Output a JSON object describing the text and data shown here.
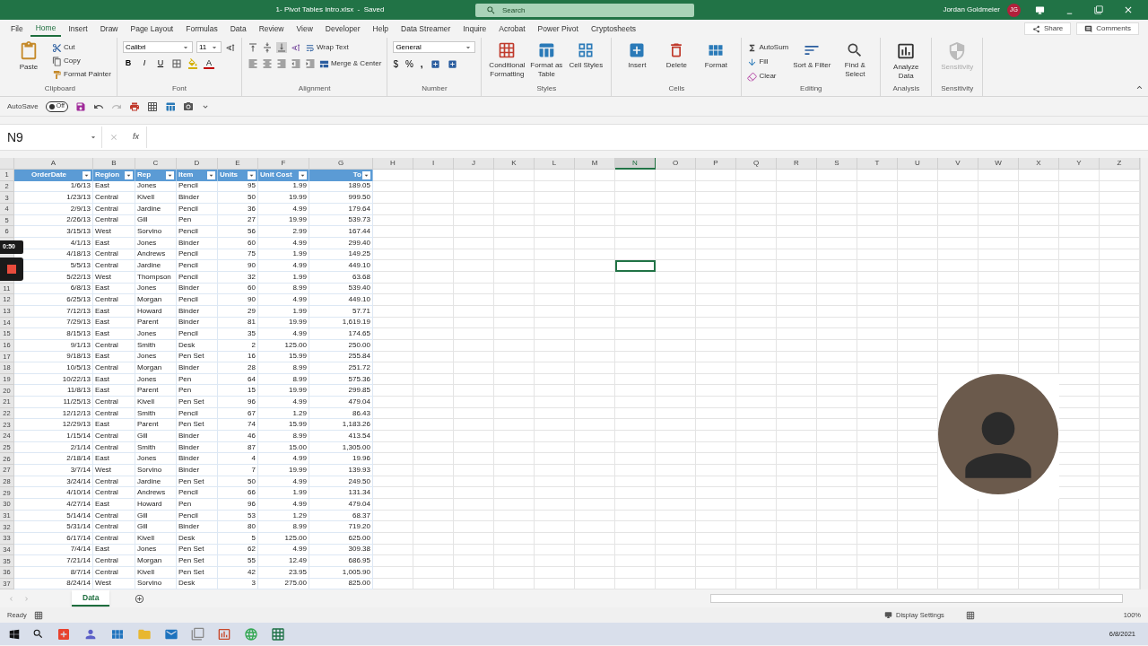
{
  "title_bar": {
    "document_title": "1- Pivot Tables Intro.xlsx  -  Saved",
    "search_placeholder": "Search",
    "user_name": "Jordan Goldmeier",
    "user_initials": "JG"
  },
  "menu_tabs": [
    {
      "label": "File",
      "selected": false
    },
    {
      "label": "Home",
      "selected": true
    },
    {
      "label": "Insert",
      "selected": false
    },
    {
      "label": "Draw",
      "selected": false
    },
    {
      "label": "Page Layout",
      "selected": false
    },
    {
      "label": "Formulas",
      "selected": false
    },
    {
      "label": "Data",
      "selected": false
    },
    {
      "label": "Review",
      "selected": false
    },
    {
      "label": "View",
      "selected": false
    },
    {
      "label": "Developer",
      "selected": false
    },
    {
      "label": "Help",
      "selected": false
    },
    {
      "label": "Data Streamer",
      "selected": false
    },
    {
      "label": "Inquire",
      "selected": false
    },
    {
      "label": "Acrobat",
      "selected": false
    },
    {
      "label": "Power Pivot",
      "selected": false
    },
    {
      "label": "Cryptosheets",
      "selected": false
    }
  ],
  "share": "Share",
  "comments": "Comments",
  "ribbon": {
    "groups": [
      {
        "kind": "clipboard",
        "label": "Clipboard",
        "paste": "Paste",
        "cut": "Cut",
        "copy": "Copy",
        "format_painter": "Format Painter"
      },
      {
        "kind": "font",
        "label": "Font",
        "font_name": "Calibri",
        "font_size": "11",
        "bold": "B",
        "italic": "I",
        "underline": "U",
        "font_color": "A"
      },
      {
        "kind": "alignment",
        "label": "Alignment",
        "wrap_text": "Wrap Text",
        "merge_center": "Merge & Center"
      },
      {
        "kind": "number",
        "label": "Number",
        "format": "General",
        "currency": "$",
        "percent": "%",
        "comma": ","
      },
      {
        "kind": "styles",
        "label": "Styles",
        "buttons": [
          "Conditional Formatting",
          "Format as Table",
          "Cell Styles"
        ]
      },
      {
        "kind": "cells",
        "label": "Cells",
        "buttons": [
          "Insert",
          "Delete",
          "Format"
        ]
      },
      {
        "kind": "editing",
        "label": "Editing",
        "autosum": "AutoSum",
        "fill": "Fill",
        "clear": "Clear",
        "buttons": [
          "Sort & Filter",
          "Find & Select"
        ]
      },
      {
        "kind": "analysis",
        "label": "Analysis",
        "buttons": [
          "Analyze Data"
        ],
        "disabled": false
      },
      {
        "kind": "sensitivity",
        "label": "Sensitivity",
        "buttons": [
          "Sensitivity"
        ],
        "disabled": true
      }
    ]
  },
  "quick_access": {
    "autosave_label": "AutoSave",
    "autosave_state": "Off",
    "autosave_on": false
  },
  "formula_bar": {
    "name_box": "N9",
    "fx": "fx"
  },
  "columns": [
    {
      "label": "A",
      "selected": false
    },
    {
      "label": "B",
      "selected": false
    },
    {
      "label": "C",
      "selected": false
    },
    {
      "label": "D",
      "selected": false
    },
    {
      "label": "E",
      "selected": false
    },
    {
      "label": "F",
      "selected": false
    },
    {
      "label": "G",
      "selected": false
    },
    {
      "label": "H",
      "selected": false
    },
    {
      "label": "I",
      "selected": false
    },
    {
      "label": "J",
      "selected": false
    },
    {
      "label": "K",
      "selected": false
    },
    {
      "label": "L",
      "selected": false
    },
    {
      "label": "M",
      "selected": false
    },
    {
      "label": "N",
      "selected": true
    },
    {
      "label": "O",
      "selected": false
    },
    {
      "label": "P",
      "selected": false
    },
    {
      "label": "Q",
      "selected": false
    },
    {
      "label": "R",
      "selected": false
    },
    {
      "label": "S",
      "selected": false
    },
    {
      "label": "T",
      "selected": false
    },
    {
      "label": "U",
      "selected": false
    },
    {
      "label": "V",
      "selected": false
    },
    {
      "label": "W",
      "selected": false
    },
    {
      "label": "X",
      "selected": false
    },
    {
      "label": "Y",
      "selected": false
    },
    {
      "label": "Z",
      "selected": false
    }
  ],
  "rows": [
    {
      "kind": "header",
      "number": "1",
      "selected": false,
      "cells": [
        "OrderDate",
        "Region",
        "Rep",
        "Item",
        "Units",
        "Unit Cost",
        "To"
      ]
    },
    {
      "kind": "data",
      "number": "2",
      "selected": false,
      "cells": [
        "1/6/13",
        "East",
        "Jones",
        "Pencil",
        "95",
        "1.99",
        "189.05"
      ]
    },
    {
      "kind": "data",
      "number": "3",
      "selected": false,
      "cells": [
        "1/23/13",
        "Central",
        "Kivell",
        "Binder",
        "50",
        "19.99",
        "999.50"
      ]
    },
    {
      "kind": "data",
      "number": "4",
      "selected": false,
      "cells": [
        "2/9/13",
        "Central",
        "Jardine",
        "Pencil",
        "36",
        "4.99",
        "179.64"
      ]
    },
    {
      "kind": "data",
      "number": "5",
      "selected": false,
      "cells": [
        "2/26/13",
        "Central",
        "Gill",
        "Pen",
        "27",
        "19.99",
        "539.73"
      ]
    },
    {
      "kind": "data",
      "number": "6",
      "selected": false,
      "cells": [
        "3/15/13",
        "West",
        "Sorvino",
        "Pencil",
        "56",
        "2.99",
        "167.44"
      ]
    },
    {
      "kind": "data",
      "selected": false,
      "cells": [
        "4/1/13",
        "East",
        "Jones",
        "Binder",
        "60",
        "4.99",
        "299.40"
      ]
    },
    {
      "kind": "data",
      "selected": false,
      "cells": [
        "4/18/13",
        "Central",
        "Andrews",
        "Pencil",
        "75",
        "1.99",
        "149.25"
      ]
    },
    {
      "kind": "data",
      "selected": true,
      "cells": [
        "5/5/13",
        "Central",
        "Jardine",
        "Pencil",
        "90",
        "4.99",
        "449.10"
      ]
    },
    {
      "kind": "data",
      "selected": false,
      "cells": [
        "5/22/13",
        "West",
        "Thompson",
        "Pencil",
        "32",
        "1.99",
        "63.68"
      ]
    },
    {
      "kind": "data",
      "number": "11",
      "selected": false,
      "cells": [
        "6/8/13",
        "East",
        "Jones",
        "Binder",
        "60",
        "8.99",
        "539.40"
      ]
    },
    {
      "kind": "data",
      "number": "12",
      "selected": false,
      "cells": [
        "6/25/13",
        "Central",
        "Morgan",
        "Pencil",
        "90",
        "4.99",
        "449.10"
      ]
    },
    {
      "kind": "data",
      "number": "13",
      "selected": false,
      "cells": [
        "7/12/13",
        "East",
        "Howard",
        "Binder",
        "29",
        "1.99",
        "57.71"
      ]
    },
    {
      "kind": "data",
      "number": "14",
      "selected": false,
      "cells": [
        "7/29/13",
        "East",
        "Parent",
        "Binder",
        "81",
        "19.99",
        "1,619.19"
      ]
    },
    {
      "kind": "data",
      "number": "15",
      "selected": false,
      "cells": [
        "8/15/13",
        "East",
        "Jones",
        "Pencil",
        "35",
        "4.99",
        "174.65"
      ]
    },
    {
      "kind": "data",
      "number": "16",
      "selected": false,
      "cells": [
        "9/1/13",
        "Central",
        "Smith",
        "Desk",
        "2",
        "125.00",
        "250.00"
      ]
    },
    {
      "kind": "data",
      "number": "17",
      "selected": false,
      "cells": [
        "9/18/13",
        "East",
        "Jones",
        "Pen Set",
        "16",
        "15.99",
        "255.84"
      ]
    },
    {
      "kind": "data",
      "number": "18",
      "selected": false,
      "cells": [
        "10/5/13",
        "Central",
        "Morgan",
        "Binder",
        "28",
        "8.99",
        "251.72"
      ]
    },
    {
      "kind": "data",
      "number": "19",
      "selected": false,
      "cells": [
        "10/22/13",
        "East",
        "Jones",
        "Pen",
        "64",
        "8.99",
        "575.36"
      ]
    },
    {
      "kind": "data",
      "number": "20",
      "selected": false,
      "cells": [
        "11/8/13",
        "East",
        "Parent",
        "Pen",
        "15",
        "19.99",
        "299.85"
      ]
    },
    {
      "kind": "data",
      "number": "21",
      "selected": false,
      "cells": [
        "11/25/13",
        "Central",
        "Kivell",
        "Pen Set",
        "96",
        "4.99",
        "479.04"
      ]
    },
    {
      "kind": "data",
      "number": "22",
      "selected": false,
      "cells": [
        "12/12/13",
        "Central",
        "Smith",
        "Pencil",
        "67",
        "1.29",
        "86.43"
      ]
    },
    {
      "kind": "data",
      "number": "23",
      "selected": false,
      "cells": [
        "12/29/13",
        "East",
        "Parent",
        "Pen Set",
        "74",
        "15.99",
        "1,183.26"
      ]
    },
    {
      "kind": "data",
      "number": "24",
      "selected": false,
      "cells": [
        "1/15/14",
        "Central",
        "Gill",
        "Binder",
        "46",
        "8.99",
        "413.54"
      ]
    },
    {
      "kind": "data",
      "number": "25",
      "selected": false,
      "cells": [
        "2/1/14",
        "Central",
        "Smith",
        "Binder",
        "87",
        "15.00",
        "1,305.00"
      ]
    },
    {
      "kind": "data",
      "number": "26",
      "selected": false,
      "cells": [
        "2/18/14",
        "East",
        "Jones",
        "Binder",
        "4",
        "4.99",
        "19.96"
      ]
    },
    {
      "kind": "data",
      "number": "27",
      "selected": false,
      "cells": [
        "3/7/14",
        "West",
        "Sorvino",
        "Binder",
        "7",
        "19.99",
        "139.93"
      ]
    },
    {
      "kind": "data",
      "number": "28",
      "selected": false,
      "cells": [
        "3/24/14",
        "Central",
        "Jardine",
        "Pen Set",
        "50",
        "4.99",
        "249.50"
      ]
    },
    {
      "kind": "data",
      "number": "29",
      "selected": false,
      "cells": [
        "4/10/14",
        "Central",
        "Andrews",
        "Pencil",
        "66",
        "1.99",
        "131.34"
      ]
    },
    {
      "kind": "data",
      "number": "30",
      "selected": false,
      "cells": [
        "4/27/14",
        "East",
        "Howard",
        "Pen",
        "96",
        "4.99",
        "479.04"
      ]
    },
    {
      "kind": "data",
      "number": "31",
      "selected": false,
      "cells": [
        "5/14/14",
        "Central",
        "Gill",
        "Pencil",
        "53",
        "1.29",
        "68.37"
      ]
    },
    {
      "kind": "data",
      "number": "32",
      "selected": false,
      "cells": [
        "5/31/14",
        "Central",
        "Gill",
        "Binder",
        "80",
        "8.99",
        "719.20"
      ]
    },
    {
      "kind": "data",
      "number": "33",
      "selected": false,
      "cells": [
        "6/17/14",
        "Central",
        "Kivell",
        "Desk",
        "5",
        "125.00",
        "625.00"
      ]
    },
    {
      "kind": "data",
      "number": "34",
      "selected": false,
      "cells": [
        "7/4/14",
        "East",
        "Jones",
        "Pen Set",
        "62",
        "4.99",
        "309.38"
      ]
    },
    {
      "kind": "data",
      "number": "35",
      "selected": false,
      "cells": [
        "7/21/14",
        "Central",
        "Morgan",
        "Pen Set",
        "55",
        "12.49",
        "686.95"
      ]
    },
    {
      "kind": "data",
      "number": "36",
      "selected": false,
      "cells": [
        "8/7/14",
        "Central",
        "Kivell",
        "Pen Set",
        "42",
        "23.95",
        "1,005.90"
      ]
    },
    {
      "kind": "data",
      "number": "37",
      "selected": false,
      "cells": [
        "8/24/14",
        "West",
        "Sorvino",
        "Desk",
        "3",
        "275.00",
        "825.00"
      ]
    }
  ],
  "recorder": {
    "time": "0:50"
  },
  "sheet_tabs": [
    {
      "label": "Data",
      "selected": true
    }
  ],
  "status_bar": {
    "status": "Ready",
    "display_settings": "Display Settings",
    "zoom": "100%"
  },
  "taskbar": {
    "date": "6/8/2021"
  }
}
